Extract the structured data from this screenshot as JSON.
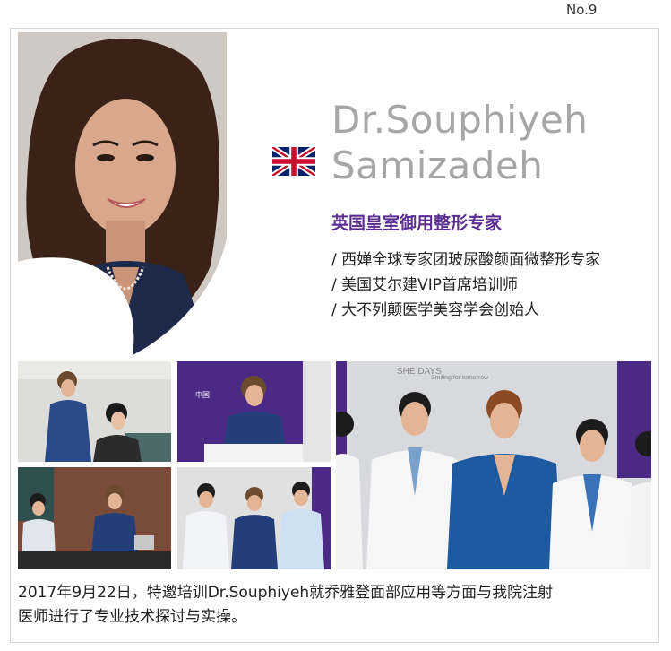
{
  "page_number": "No.9",
  "profile": {
    "name_line1": "Dr.Souphiyeh",
    "name_line2": "Samizadeh",
    "flag_icon": "uk-flag-icon",
    "headline": "英国皇室御用整形专家",
    "credentials": [
      "/ 西婵全球专家团玻尿酸颜面微整形专家",
      "/ 美国艾尔建VIP首席培训师",
      "/ 大不列颠医学美容学会创始人"
    ]
  },
  "colors": {
    "headline": "#5b2d90",
    "name": "#a6a6a6",
    "brand_purple": "#4b2a86"
  },
  "caption": {
    "line1": "2017年9月22日，特邀培训Dr.Souphiyeh就乔雅登面部应用等方面与我院注射",
    "line2": "医师进行了专业技术探讨与实操。"
  }
}
